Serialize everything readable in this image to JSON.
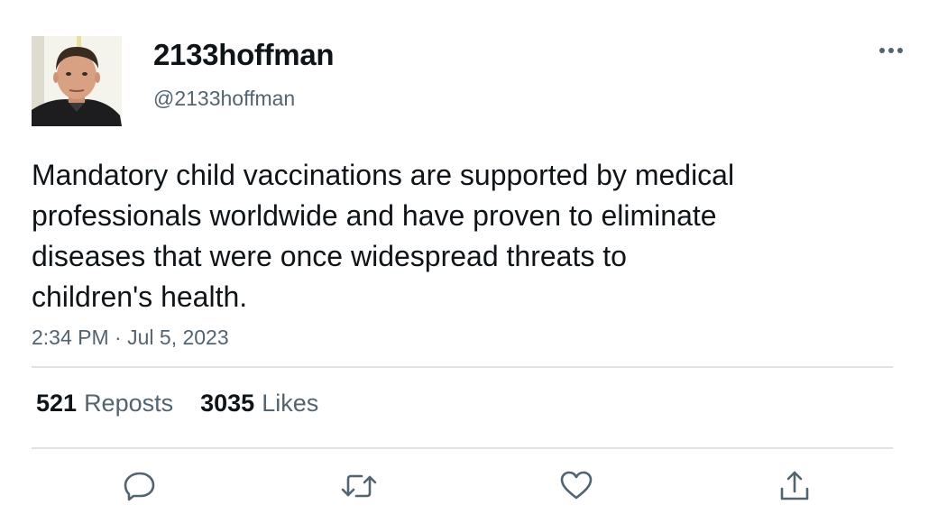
{
  "author": {
    "display_name": "2133hoffman",
    "handle": "@2133hoffman"
  },
  "tweet": {
    "text": "Mandatory child vaccinations are supported by medical\nprofessionals worldwide and have proven to eliminate\ndiseases that were once widespread threats to\nchildren's health.",
    "time": "2:34 PM",
    "separator": "·",
    "date": "Jul 5, 2023"
  },
  "stats": {
    "reposts_count": "521",
    "reposts_label": "Reposts",
    "likes_count": "3035",
    "likes_label": "Likes"
  },
  "actions": {
    "reply_icon": "reply-icon",
    "retweet_icon": "retweet-icon",
    "like_icon": "heart-icon",
    "share_icon": "share-icon"
  },
  "colors": {
    "text_primary": "#0f1419",
    "text_secondary": "#536471",
    "divider": "#dfe3e6"
  }
}
